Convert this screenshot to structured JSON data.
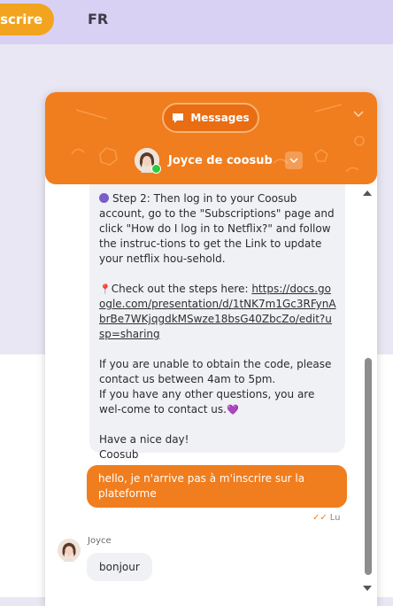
{
  "topbar": {
    "signup_label": "nscrire",
    "lang_label": "FR"
  },
  "chat": {
    "tab_label": "Messages",
    "agent_name": "Joyce de coosub",
    "incoming_message": {
      "step2": "Step 2: Then log in to your Coosub account, go to the \"Subscriptions\" page and click \"How do I log in to Netflix?\" and follow the instruc-tions to get the Link to update your netflix hou-sehold.",
      "steps_prefix": "Check out the steps here: ",
      "steps_link": "https://docs.google.com/presentation/d/1tNK7m1Gc3RFynAbrBe7WKjqgdkMSwze18bsG40ZbcZo/edit?usp=sharing",
      "unable": "If you are unable to obtain the code, please contact us between 4am to 5pm.",
      "other": "If you have any other questions, you are wel-come to contact us.",
      "closing": "Have a nice day!",
      "signature": "Coosub"
    },
    "outgoing_message": "hello, je n'arrive pas à m'inscrire sur la plateforme",
    "read_status": "Lu",
    "reply": {
      "name": "Joyce",
      "text": "bonjour"
    }
  },
  "colors": {
    "accent": "#f07d1e",
    "topbar": "#d8d1f3",
    "signup_button": "#f2a41e",
    "bubble_in": "#f0f1f5",
    "online": "#2ecc40"
  },
  "icons": {
    "messages": "chat-bubble-icon",
    "collapse": "chevron-down-icon",
    "agent_menu": "chevron-down-icon",
    "step": "purple-circle-icon",
    "steps": "pushpin-icon",
    "heart": "purple-heart-icon",
    "read": "double-check-icon"
  }
}
